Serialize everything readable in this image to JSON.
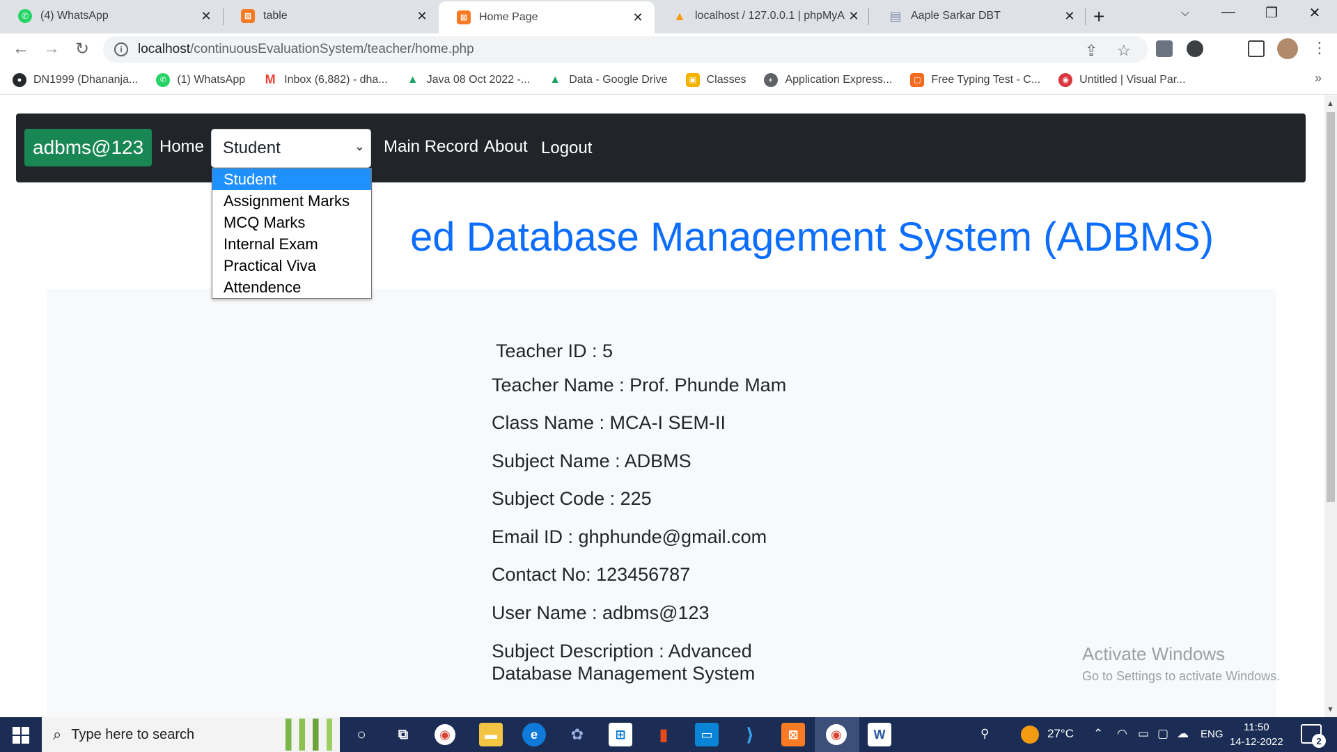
{
  "browser": {
    "tabs": [
      {
        "title": "(4) WhatsApp",
        "icon": "whatsapp-icon",
        "color": "#25d366",
        "glyph": "✆"
      },
      {
        "title": "table",
        "icon": "xampp-icon",
        "color": "#fb7a24",
        "glyph": "⊠"
      },
      {
        "title": "Home Page",
        "icon": "xampp-icon",
        "color": "#fb7a24",
        "glyph": "⊠"
      },
      {
        "title": "localhost / 127.0.0.1 | phpMyA",
        "icon": "phpmyadmin-icon",
        "color": "#f89c0e",
        "glyph": "▲"
      },
      {
        "title": "Aaple Sarkar DBT",
        "icon": "document-icon",
        "color": "#7a8ca8",
        "glyph": "▤"
      }
    ],
    "url_host": "localhost",
    "url_path": "/continuousEvaluationSystem/teacher/home.php",
    "bookmarks": [
      {
        "label": "DN1999 (Dhananja...",
        "icon": "github-icon",
        "color": "#24292e"
      },
      {
        "label": "(1) WhatsApp",
        "icon": "whatsapp-icon",
        "color": "#25d366"
      },
      {
        "label": "Inbox (6,882) - dha...",
        "icon": "gmail-icon",
        "color": "#ea4335"
      },
      {
        "label": "Java 08 Oct 2022 -...",
        "icon": "google-drive-icon",
        "color": "#1fa463"
      },
      {
        "label": "Data - Google Drive",
        "icon": "google-drive-icon",
        "color": "#1fa463"
      },
      {
        "label": "Classes",
        "icon": "classroom-icon",
        "color": "#f4b400"
      },
      {
        "label": "Application Express...",
        "icon": "globe-icon",
        "color": "#5f6368"
      },
      {
        "label": "Free Typing Test - C...",
        "icon": "chat-icon",
        "color": "#f56b1f"
      },
      {
        "label": "Untitled | Visual Par...",
        "icon": "visual-paradigm-icon",
        "color": "#d9363e"
      }
    ],
    "bookmarks_more": "»"
  },
  "site": {
    "brand": "adbms@123",
    "nav_home": "Home",
    "nav_select_value": "Student",
    "nav_main_record": "Main Record",
    "nav_about": "About",
    "nav_logout": "Logout",
    "dropdown_options": [
      "Student",
      "Assignment Marks",
      "MCQ Marks",
      "Internal Exam",
      "Practical Viva",
      "Attendence"
    ],
    "heading_visible": "ed Database Management System (ADBMS)",
    "accent_color": "#0d6efd",
    "brand_color": "#198754"
  },
  "teacher": {
    "teacher_id": "Teacher ID : 5",
    "teacher_name": "Teacher Name : Prof. Phunde Mam",
    "class_name": "Class Name : MCA-I SEM-II",
    "subject_name": "Subject Name : ADBMS",
    "subject_code": "Subject Code : 225",
    "email": "Email ID : ghphunde@gmail.com",
    "contact": "Contact No: 123456787",
    "user_name": "User Name : adbms@123",
    "description": "Subject Description : Advanced Database Management System"
  },
  "watermark": {
    "line1": "Activate Windows",
    "line2": "Go to Settings to activate Windows."
  },
  "taskbar": {
    "search_placeholder": "Type here to search",
    "temperature": "27°C",
    "language": "ENG",
    "time": "11:50",
    "date": "14-12-2022",
    "notification_count": "2"
  }
}
